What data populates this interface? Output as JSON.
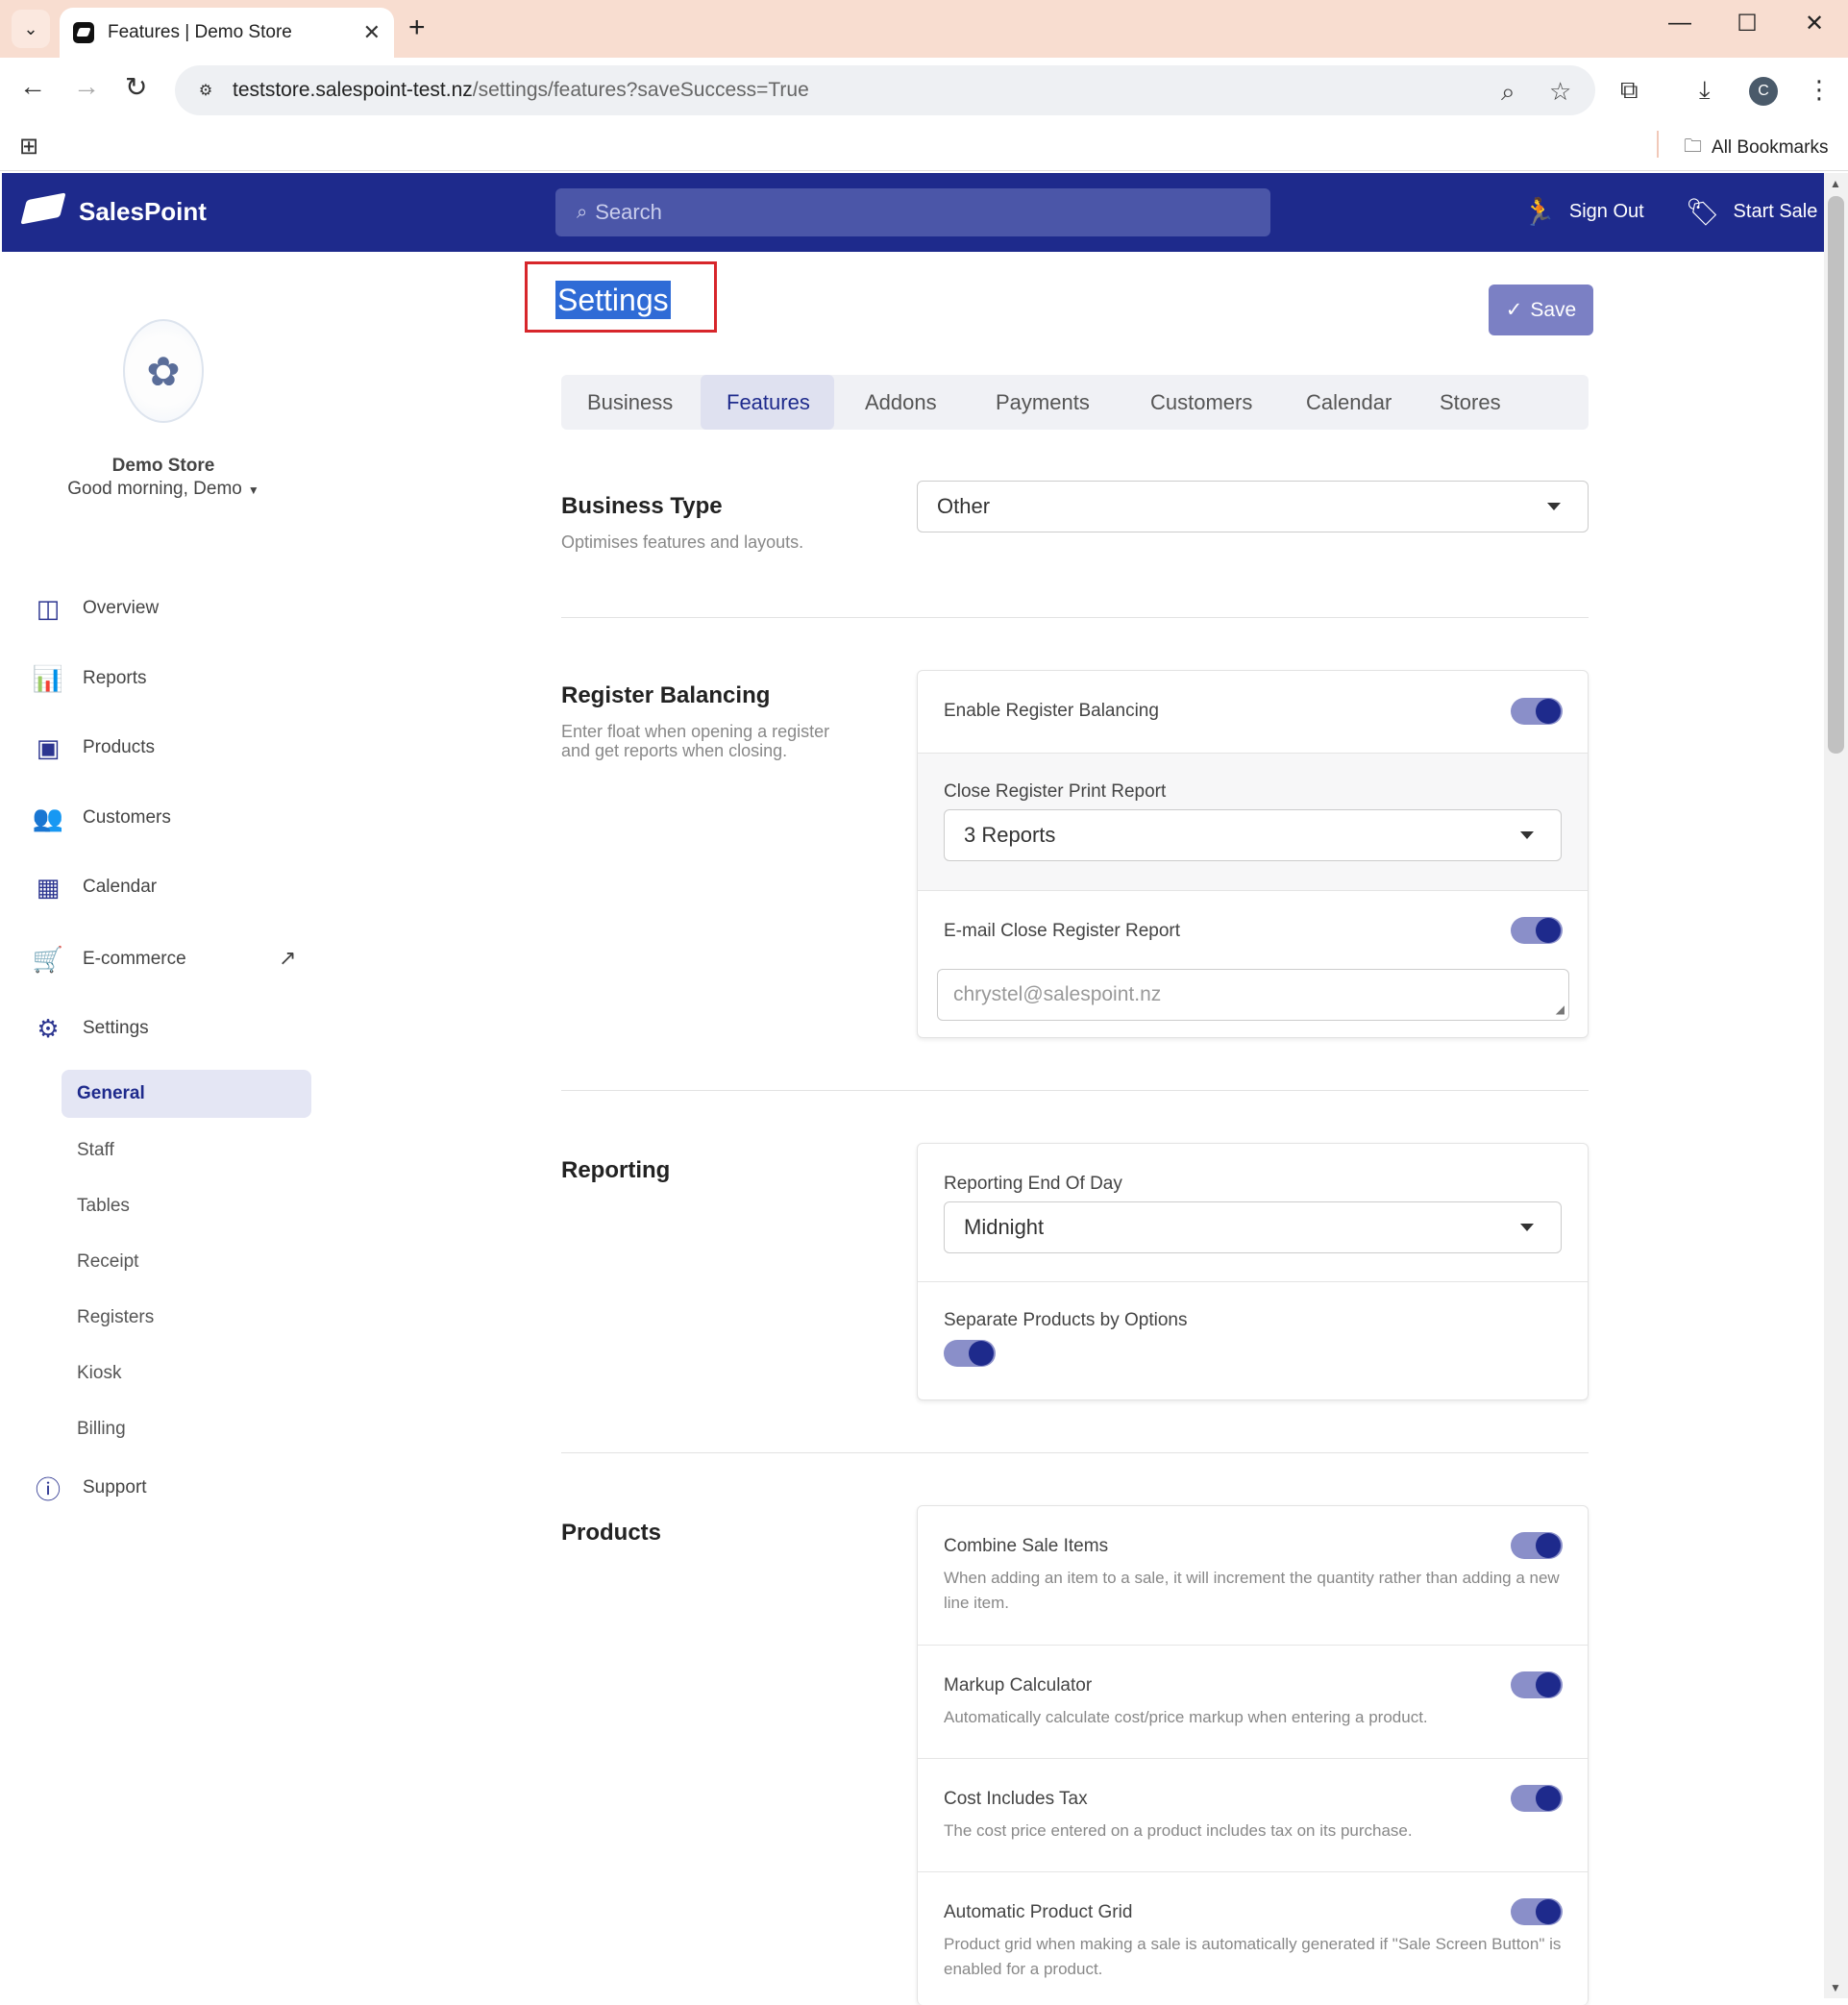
{
  "browser": {
    "tab_title": "Features | Demo Store",
    "url_host": "teststore.salespoint-test.nz",
    "url_path": "/settings/features?saveSuccess=True",
    "all_bookmarks": "All Bookmarks",
    "profile_initial": "C"
  },
  "header": {
    "brand": "SalesPoint",
    "search_placeholder": "Search",
    "sign_out": "Sign Out",
    "start_sale": "Start Sale",
    "brand_color": "#1e2a8c"
  },
  "sidebar": {
    "store_name": "Demo Store",
    "greeting": "Good morning, Demo",
    "items": [
      {
        "label": "Overview",
        "icon": "overview-icon"
      },
      {
        "label": "Reports",
        "icon": "bar-chart-icon"
      },
      {
        "label": "Products",
        "icon": "box-icon"
      },
      {
        "label": "Customers",
        "icon": "users-icon"
      },
      {
        "label": "Calendar",
        "icon": "calendar-icon"
      },
      {
        "label": "E-commerce",
        "icon": "cart-icon"
      },
      {
        "label": "Settings",
        "icon": "gears-icon"
      },
      {
        "label": "Support",
        "icon": "question-icon"
      }
    ],
    "settings_sub": [
      "General",
      "Staff",
      "Tables",
      "Receipt",
      "Registers",
      "Kiosk",
      "Billing"
    ]
  },
  "page": {
    "title": "Settings",
    "save_label": "Save",
    "tabs": [
      "Business",
      "Features",
      "Addons",
      "Payments",
      "Customers",
      "Calendar",
      "Stores"
    ],
    "active_tab": "Features"
  },
  "business_type": {
    "title": "Business Type",
    "desc": "Optimises features and layouts.",
    "value": "Other"
  },
  "register_balancing": {
    "title": "Register Balancing",
    "desc": "Enter float when opening a register and get reports when closing.",
    "enable_label": "Enable Register Balancing",
    "enable_on": true,
    "print_label": "Close Register Print Report",
    "print_value": "3 Reports",
    "email_label": "E-mail Close Register Report",
    "email_on": true,
    "email_placeholder": "chrystel@salespoint.nz"
  },
  "reporting": {
    "title": "Reporting",
    "eod_label": "Reporting End Of Day",
    "eod_value": "Midnight",
    "separate_label": "Separate Products by Options",
    "separate_on": true
  },
  "products": {
    "title": "Products",
    "items": [
      {
        "label": "Combine Sale Items",
        "hint": "When adding an item to a sale, it will increment the quantity rather than adding a new line item.",
        "on": true
      },
      {
        "label": "Markup Calculator",
        "hint": "Automatically calculate cost/price markup when entering a product.",
        "on": true
      },
      {
        "label": "Cost Includes Tax",
        "hint": "The cost price entered on a product includes tax on its purchase.",
        "on": true
      },
      {
        "label": "Automatic Product Grid",
        "hint": "Product grid when making a sale is automatically generated if \"Sale Screen Button\" is enabled for a product.",
        "on": true
      }
    ]
  }
}
